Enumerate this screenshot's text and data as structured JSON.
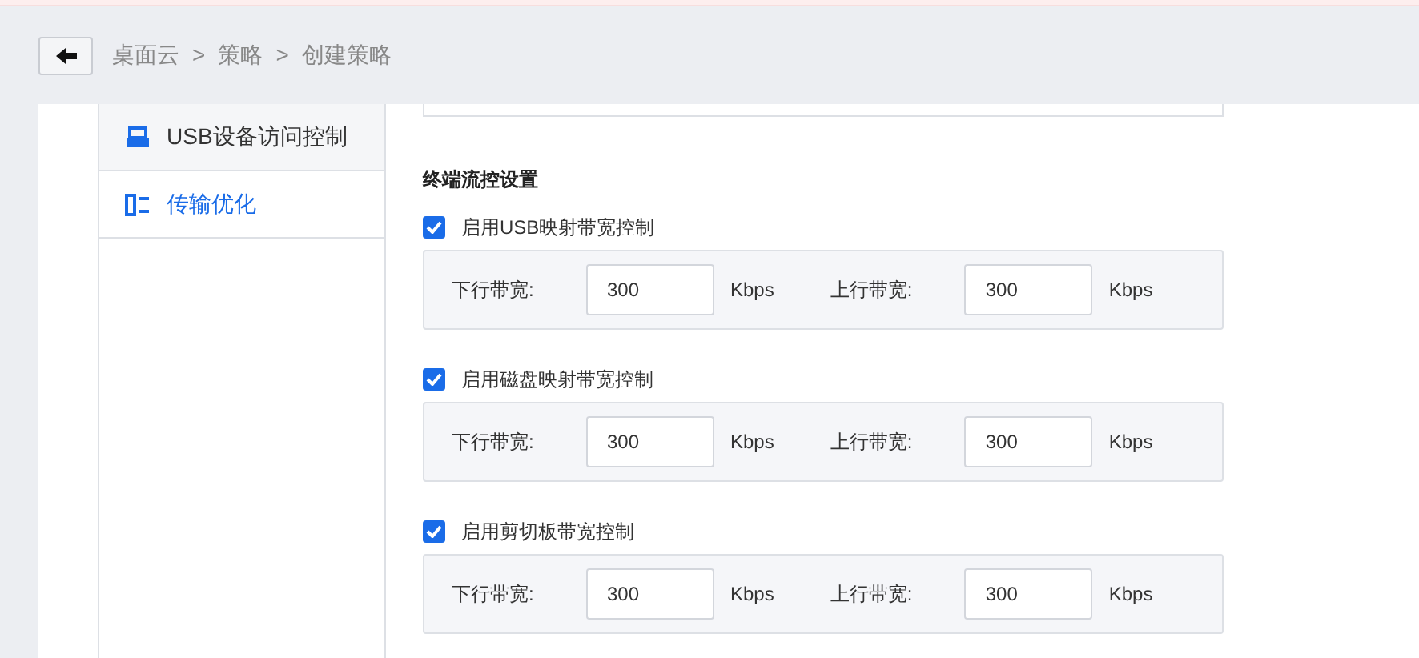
{
  "breadcrumb": [
    "桌面云",
    ">",
    "策略",
    ">",
    "创建策略"
  ],
  "sidebar": {
    "items": [
      {
        "label": "USB设备访问控制",
        "kind": "usb",
        "selected": false
      },
      {
        "label": "传输优化",
        "kind": "transfer",
        "selected": true
      }
    ]
  },
  "section_title": "终端流控设置",
  "groups": [
    {
      "label": "启用USB映射带宽控制",
      "checked": true,
      "fields": [
        {
          "label": "下行带宽:",
          "value": "300",
          "unit": "Kbps"
        },
        {
          "label": "上行带宽:",
          "value": "300",
          "unit": "Kbps"
        }
      ]
    },
    {
      "label": "启用磁盘映射带宽控制",
      "checked": true,
      "fields": [
        {
          "label": "下行带宽:",
          "value": "300",
          "unit": "Kbps"
        },
        {
          "label": "上行带宽:",
          "value": "300",
          "unit": "Kbps"
        }
      ]
    },
    {
      "label": "启用剪切板带宽控制",
      "checked": true,
      "fields": [
        {
          "label": "下行带宽:",
          "value": "300",
          "unit": "Kbps"
        },
        {
          "label": "上行带宽:",
          "value": "300",
          "unit": "Kbps"
        }
      ]
    }
  ]
}
